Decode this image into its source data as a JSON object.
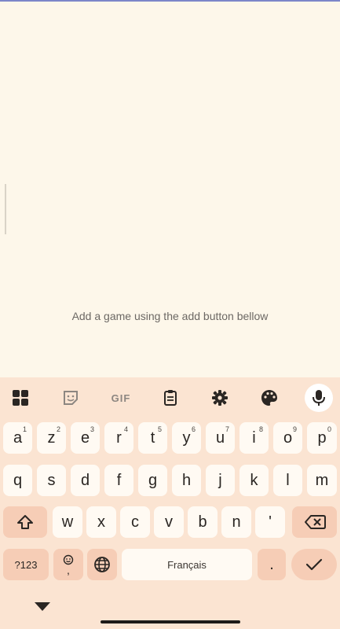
{
  "empty_state": {
    "message": "Add a game using the add button bellow"
  },
  "keyboard": {
    "toolbar": {
      "gif_label": "GIF"
    },
    "row1": [
      {
        "key": "a",
        "hint": "1"
      },
      {
        "key": "z",
        "hint": "2"
      },
      {
        "key": "e",
        "hint": "3"
      },
      {
        "key": "r",
        "hint": "4"
      },
      {
        "key": "t",
        "hint": "5"
      },
      {
        "key": "y",
        "hint": "6"
      },
      {
        "key": "u",
        "hint": "7"
      },
      {
        "key": "i",
        "hint": "8"
      },
      {
        "key": "o",
        "hint": "9"
      },
      {
        "key": "p",
        "hint": "0"
      }
    ],
    "row2": [
      "q",
      "s",
      "d",
      "f",
      "g",
      "h",
      "j",
      "k",
      "l",
      "m"
    ],
    "row3": [
      "w",
      "x",
      "c",
      "v",
      "b",
      "n",
      "'"
    ],
    "symbols_label": "?123",
    "emoji_comma": ",",
    "space_label": "Français",
    "period_label": "."
  }
}
